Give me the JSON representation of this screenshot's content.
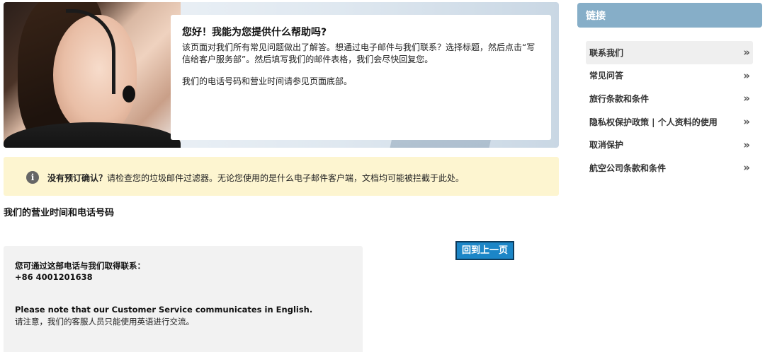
{
  "hero": {
    "title": "您好！我能为您提供什么帮助吗?",
    "text": "该页面对我们所有常见问题做出了解答。想通过电子邮件与我们联系？选择标题，然后点击“写信给客户服务部”。然后填写我们的邮件表格，我们会尽快回复您。",
    "text2": "我们的电话号码和营业时间请参见页面底部。"
  },
  "notice": {
    "bold": "没有预订确认？",
    "text": "请检查您的垃圾邮件过滤器。无论您使用的是什么电子邮件客户端，文档均可能被拦截于此处。",
    "icon": "info-icon"
  },
  "section_title": "我们的营业时间和电话号码",
  "back_button": "回到上一页",
  "contact": {
    "label": "您可通过这部电话与我们取得联系：",
    "phone": "+86 4001201638",
    "note_en": "Please note that our Customer Service communicates in English.",
    "note_zh": "请注意，我们的客服人员只能使用英语进行交流。"
  },
  "sidebar": {
    "header": "链接",
    "items": [
      {
        "label": "联系我们",
        "chevron": "»"
      },
      {
        "label": "常见问答",
        "chevron": "»"
      },
      {
        "label": "旅行条款和条件",
        "chevron": "»"
      },
      {
        "label": "隐私权保护政策 | 个人资料的使用",
        "chevron": "»"
      },
      {
        "label": "取消保护",
        "chevron": "»"
      },
      {
        "label": "航空公司条款和条件",
        "chevron": "»"
      }
    ]
  },
  "colors": {
    "sidebar_header": "#86aec8",
    "notice_bg": "#fdf5d0",
    "button_bg": "#1c86c7"
  }
}
